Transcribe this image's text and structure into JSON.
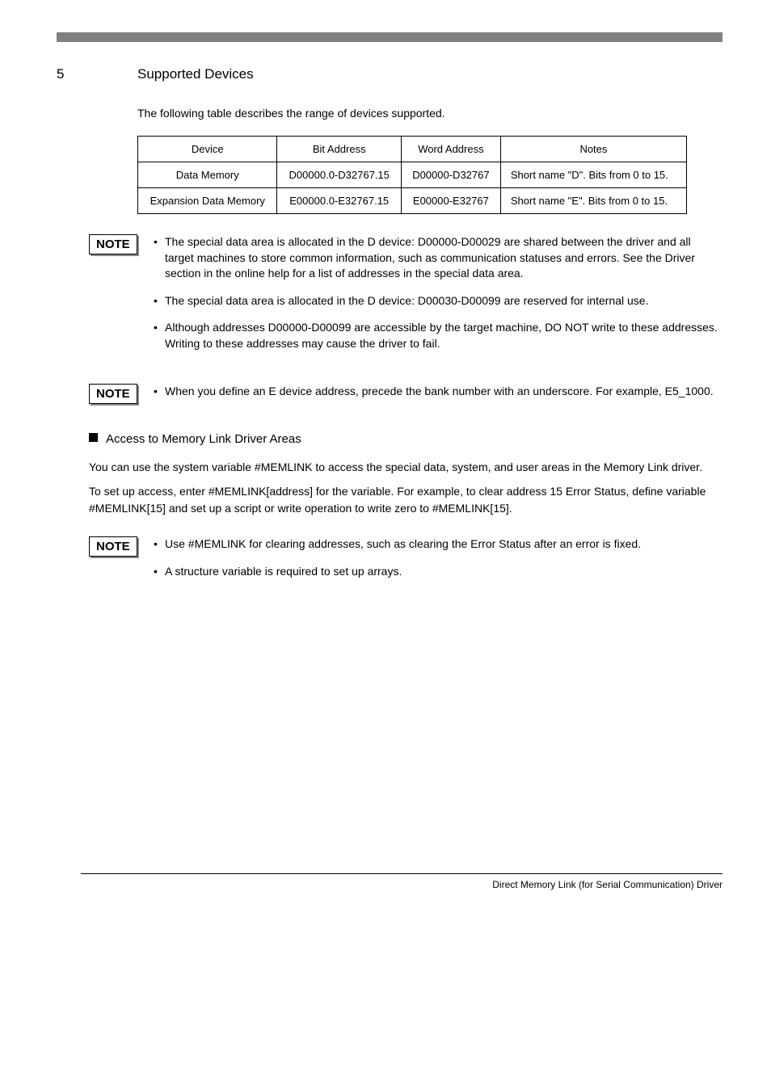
{
  "section": {
    "number": "5",
    "title": "Supported Devices"
  },
  "intro": "The following table describes the range of devices supported.",
  "table": {
    "headers": [
      "Device",
      "Bit Address",
      "Word Address",
      "Notes"
    ],
    "rows": [
      [
        "Data Memory",
        "D00000.0-D32767.15",
        "D00000-D32767",
        "Short name \"D\". Bits from 0 to 15."
      ],
      [
        "Expansion Data Memory",
        "E00000.0-E32767.15",
        "E00000-E32767",
        "Short name \"E\". Bits from 0 to 15."
      ]
    ]
  },
  "notes": {
    "first": [
      "The special data area is allocated in the D device: D00000-D00029 are shared between the driver and all target machines to store common information, such as communication statuses and errors. See the Driver section in the online help for a list of addresses in the special data area.",
      "The special data area is allocated in the D device: D00030-D00099 are reserved for internal use.",
      "Although addresses D00000-D00099 are accessible by the target machine, DO NOT write to these addresses. Writing to these addresses may cause the driver to fail."
    ],
    "second": [
      "When you define an E device address, precede the bank number with an underscore. For example, E5_1000."
    ],
    "third": [
      "Use #MEMLINK for clearing addresses, such as clearing the Error Status after an error is fixed.",
      "A structure variable is required to set up arrays."
    ]
  },
  "subsection": {
    "title": "Access to Memory Link Driver Areas",
    "body1": "You can use the system variable #MEMLINK to access the special data, system, and user areas in the Memory Link driver.",
    "body2": "To set up access, enter #MEMLINK[address] for the variable. For example, to clear address 15 Error Status, define variable #MEMLINK[15] and set up a script or write operation to write zero to #MEMLINK[15]."
  },
  "footer": "Direct Memory Link (for Serial Communication) Driver"
}
